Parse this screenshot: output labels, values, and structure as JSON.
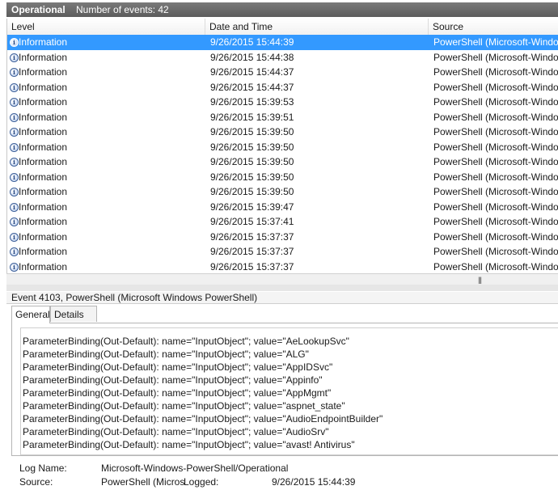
{
  "header": {
    "log_name": "Operational",
    "event_count": "Number of events: 42"
  },
  "columns": [
    "Level",
    "Date and Time",
    "Source"
  ],
  "events": [
    {
      "level": "Information",
      "date": "9/26/2015 15:44:39",
      "source": "PowerShell (Microsoft-Window",
      "selected": true
    },
    {
      "level": "Information",
      "date": "9/26/2015 15:44:38",
      "source": "PowerShell (Microsoft-Window"
    },
    {
      "level": "Information",
      "date": "9/26/2015 15:44:37",
      "source": "PowerShell (Microsoft-Window"
    },
    {
      "level": "Information",
      "date": "9/26/2015 15:44:37",
      "source": "PowerShell (Microsoft-Window"
    },
    {
      "level": "Information",
      "date": "9/26/2015 15:39:53",
      "source": "PowerShell (Microsoft-Window"
    },
    {
      "level": "Information",
      "date": "9/26/2015 15:39:51",
      "source": "PowerShell (Microsoft-Window"
    },
    {
      "level": "Information",
      "date": "9/26/2015 15:39:50",
      "source": "PowerShell (Microsoft-Window"
    },
    {
      "level": "Information",
      "date": "9/26/2015 15:39:50",
      "source": "PowerShell (Microsoft-Window"
    },
    {
      "level": "Information",
      "date": "9/26/2015 15:39:50",
      "source": "PowerShell (Microsoft-Window"
    },
    {
      "level": "Information",
      "date": "9/26/2015 15:39:50",
      "source": "PowerShell (Microsoft-Window"
    },
    {
      "level": "Information",
      "date": "9/26/2015 15:39:50",
      "source": "PowerShell (Microsoft-Window"
    },
    {
      "level": "Information",
      "date": "9/26/2015 15:39:47",
      "source": "PowerShell (Microsoft-Window"
    },
    {
      "level": "Information",
      "date": "9/26/2015 15:37:41",
      "source": "PowerShell (Microsoft-Window"
    },
    {
      "level": "Information",
      "date": "9/26/2015 15:37:37",
      "source": "PowerShell (Microsoft-Window"
    },
    {
      "level": "Information",
      "date": "9/26/2015 15:37:37",
      "source": "PowerShell (Microsoft-Window"
    },
    {
      "level": "Information",
      "date": "9/26/2015 15:37:37",
      "source": "PowerShell (Microsoft-Window"
    }
  ],
  "detail": {
    "title": "Event 4103, PowerShell (Microsoft Windows PowerShell)",
    "tabs": {
      "general": "General",
      "details": "Details"
    },
    "lines": [
      "ParameterBinding(Out-Default): name=\"InputObject\"; value=\"AeLookupSvc\"",
      "ParameterBinding(Out-Default): name=\"InputObject\"; value=\"ALG\"",
      "ParameterBinding(Out-Default): name=\"InputObject\"; value=\"AppIDSvc\"",
      "ParameterBinding(Out-Default): name=\"InputObject\"; value=\"Appinfo\"",
      "ParameterBinding(Out-Default): name=\"InputObject\"; value=\"AppMgmt\"",
      "ParameterBinding(Out-Default): name=\"InputObject\"; value=\"aspnet_state\"",
      "ParameterBinding(Out-Default): name=\"InputObject\"; value=\"AudioEndpointBuilder\"",
      "ParameterBinding(Out-Default): name=\"InputObject\"; value=\"AudioSrv\"",
      "ParameterBinding(Out-Default): name=\"InputObject\"; value=\"avast! Antivirus\""
    ],
    "fields": {
      "log_name_label": "Log Name:",
      "log_name_value": "Microsoft-Windows-PowerShell/Operational",
      "source_label": "Source:",
      "source_value": "PowerShell (Micros",
      "logged_label": "Logged:",
      "logged_value": "9/26/2015 15:44:39"
    }
  },
  "icons": {
    "info": "information-icon",
    "grip": "scroll-grip-icon"
  },
  "colors": {
    "selection": "#3399ff",
    "header_bar": "#666666"
  }
}
